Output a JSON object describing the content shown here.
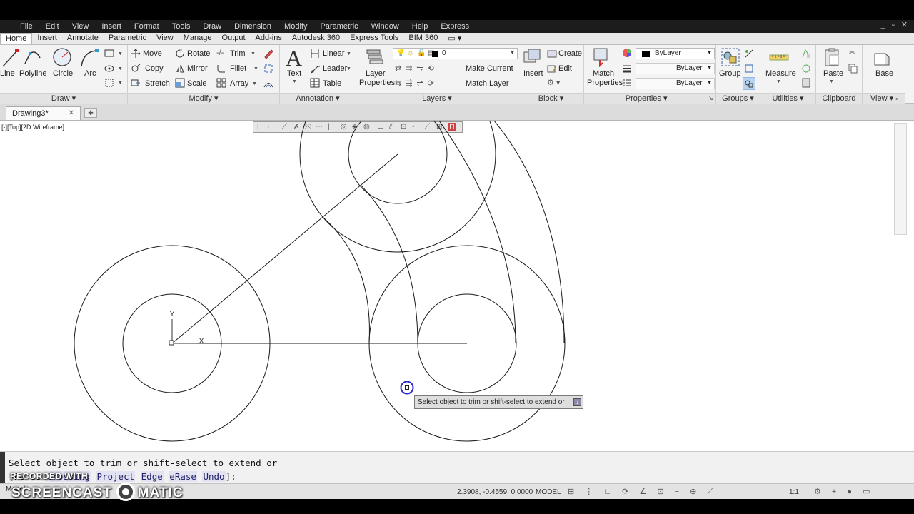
{
  "app": {
    "menu": [
      "File",
      "Edit",
      "View",
      "Insert",
      "Format",
      "Tools",
      "Draw",
      "Dimension",
      "Modify",
      "Parametric",
      "Window",
      "Help",
      "Express"
    ],
    "window_controls": "_ ▫ ✕"
  },
  "ribbon_tabs": [
    "Home",
    "Insert",
    "Annotate",
    "Parametric",
    "View",
    "Manage",
    "Output",
    "Add-ins",
    "Autodesk 360",
    "Express Tools",
    "BIM 360"
  ],
  "ribbon": {
    "draw": {
      "title": "Draw",
      "line": "Line",
      "polyline": "Polyline",
      "circle": "Circle",
      "arc": "Arc"
    },
    "modify": {
      "title": "Modify",
      "move": "Move",
      "rotate": "Rotate",
      "trim": "Trim",
      "copy": "Copy",
      "mirror": "Mirror",
      "fillet": "Fillet",
      "stretch": "Stretch",
      "scale": "Scale",
      "array": "Array"
    },
    "annotation": {
      "title": "Annotation",
      "text": "Text",
      "linear": "Linear",
      "leader": "Leader",
      "table": "Table"
    },
    "layers": {
      "title": "Layers",
      "layer_properties": "Layer\nProperties",
      "layer_properties_1": "Layer",
      "layer_properties_2": "Properties",
      "current_layer": "0",
      "make_current": "Make Current",
      "match_layer": "Match Layer"
    },
    "block": {
      "title": "Block",
      "insert": "Insert",
      "create": "Create",
      "edit": "Edit"
    },
    "properties": {
      "title": "Properties",
      "match_1": "Match",
      "match_2": "Properties",
      "color": "ByLayer",
      "linetype": "ByLayer",
      "lineweight": "ByLayer"
    },
    "groups": {
      "title": "Groups",
      "group": "Group"
    },
    "utilities": {
      "title": "Utilities",
      "measure": "Measure"
    },
    "clipboard": {
      "title": "Clipboard",
      "paste": "Paste"
    },
    "view": {
      "title": "View",
      "base": "Base"
    }
  },
  "document": {
    "tab": "Drawing3*",
    "viewport_label": "[-][Top][2D Wireframe]"
  },
  "tooltip": "Select object to trim or shift-select to extend or",
  "command": {
    "line1": "Select object to trim or shift-select to extend or",
    "line2_prefix": "[Fence ",
    "opts": [
      "Crossing",
      "Project",
      "Edge",
      "eRase",
      "Undo"
    ],
    "line2_suffix": "]:"
  },
  "status": {
    "coords": "2.3908, -0.4559, 0.0000",
    "model": "MODEL",
    "scale": "1:1",
    "model_tab": "Model"
  },
  "watermark": {
    "line1": "RECORDED WITH",
    "line2a": "SCREENCAST",
    "line2b": "MATIC"
  },
  "colors": {
    "ribbon_bg": "#f3f3f3",
    "canvas_bg": "#ffffff",
    "menu_bg": "#1c1c1c",
    "highlight": "#2a2ad0"
  }
}
